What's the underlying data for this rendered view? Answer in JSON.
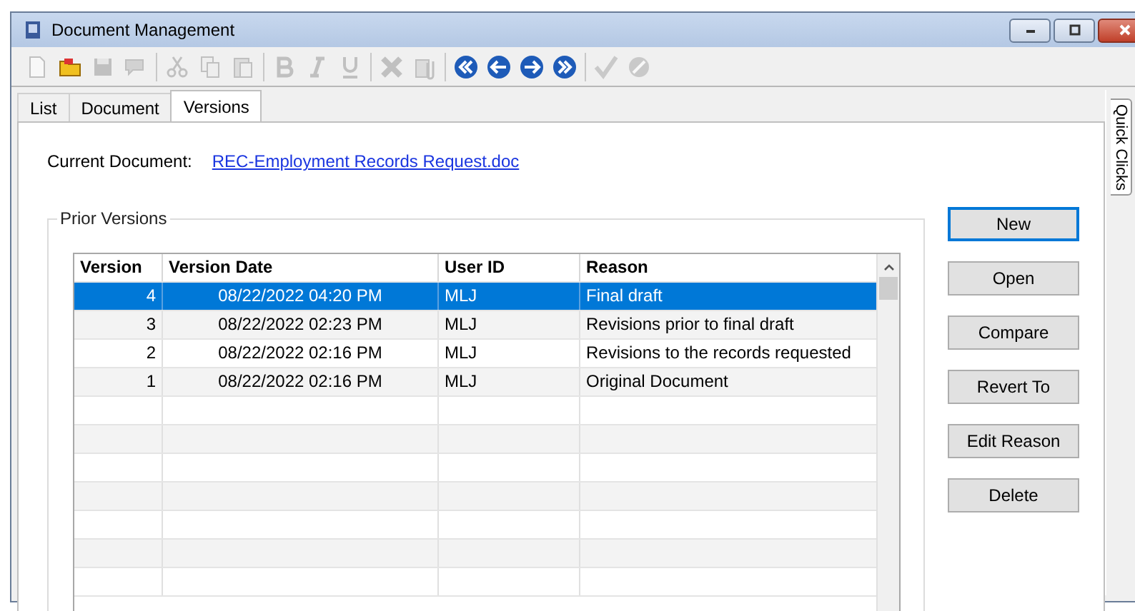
{
  "window": {
    "title": "Document Management"
  },
  "toolbar": [
    {
      "kind": "new",
      "disabled": true
    },
    {
      "kind": "open",
      "disabled": false
    },
    {
      "kind": "save",
      "disabled": true
    },
    {
      "kind": "comment",
      "disabled": true
    },
    {
      "kind": "sep"
    },
    {
      "kind": "cut",
      "disabled": true
    },
    {
      "kind": "copy",
      "disabled": true
    },
    {
      "kind": "paste",
      "disabled": true
    },
    {
      "kind": "sep"
    },
    {
      "kind": "bold",
      "disabled": true
    },
    {
      "kind": "italic",
      "disabled": true
    },
    {
      "kind": "underline",
      "disabled": true
    },
    {
      "kind": "sep"
    },
    {
      "kind": "delete",
      "disabled": true
    },
    {
      "kind": "attach",
      "disabled": true
    },
    {
      "kind": "sep"
    },
    {
      "kind": "first",
      "disabled": false
    },
    {
      "kind": "prev",
      "disabled": false
    },
    {
      "kind": "next",
      "disabled": false
    },
    {
      "kind": "last",
      "disabled": false
    },
    {
      "kind": "sep"
    },
    {
      "kind": "accept",
      "disabled": true
    },
    {
      "kind": "cancel",
      "disabled": true
    }
  ],
  "tabs": [
    {
      "label": "List",
      "selected": false
    },
    {
      "label": "Document",
      "selected": false
    },
    {
      "label": "Versions",
      "selected": true
    }
  ],
  "side_tab": {
    "label": "Quick Clicks"
  },
  "current_document": {
    "label": "Current Document:",
    "link": "REC-Employment Records Request.doc"
  },
  "prior_versions": {
    "title": "Prior Versions",
    "table": {
      "columns": [
        "Version",
        "Version Date",
        "User ID",
        "Reason"
      ],
      "rows": [
        {
          "version": "4",
          "date": "08/22/2022 04:20 PM",
          "user": "MLJ",
          "reason": "Final draft",
          "selected": true
        },
        {
          "version": "3",
          "date": "08/22/2022 02:23 PM",
          "user": "MLJ",
          "reason": "Revisions prior to final draft",
          "selected": false
        },
        {
          "version": "2",
          "date": "08/22/2022 02:16 PM",
          "user": "MLJ",
          "reason": "Revisions to the records requested",
          "selected": false
        },
        {
          "version": "1",
          "date": "08/22/2022 02:16 PM",
          "user": "MLJ",
          "reason": "Original Document",
          "selected": false
        }
      ]
    }
  },
  "buttons": [
    {
      "label": "New",
      "focused": true
    },
    {
      "label": "Open",
      "focused": false
    },
    {
      "label": "Compare",
      "focused": false
    },
    {
      "label": "Revert To",
      "focused": false
    },
    {
      "label": "Edit Reason",
      "focused": false
    },
    {
      "label": "Delete",
      "focused": false
    }
  ]
}
